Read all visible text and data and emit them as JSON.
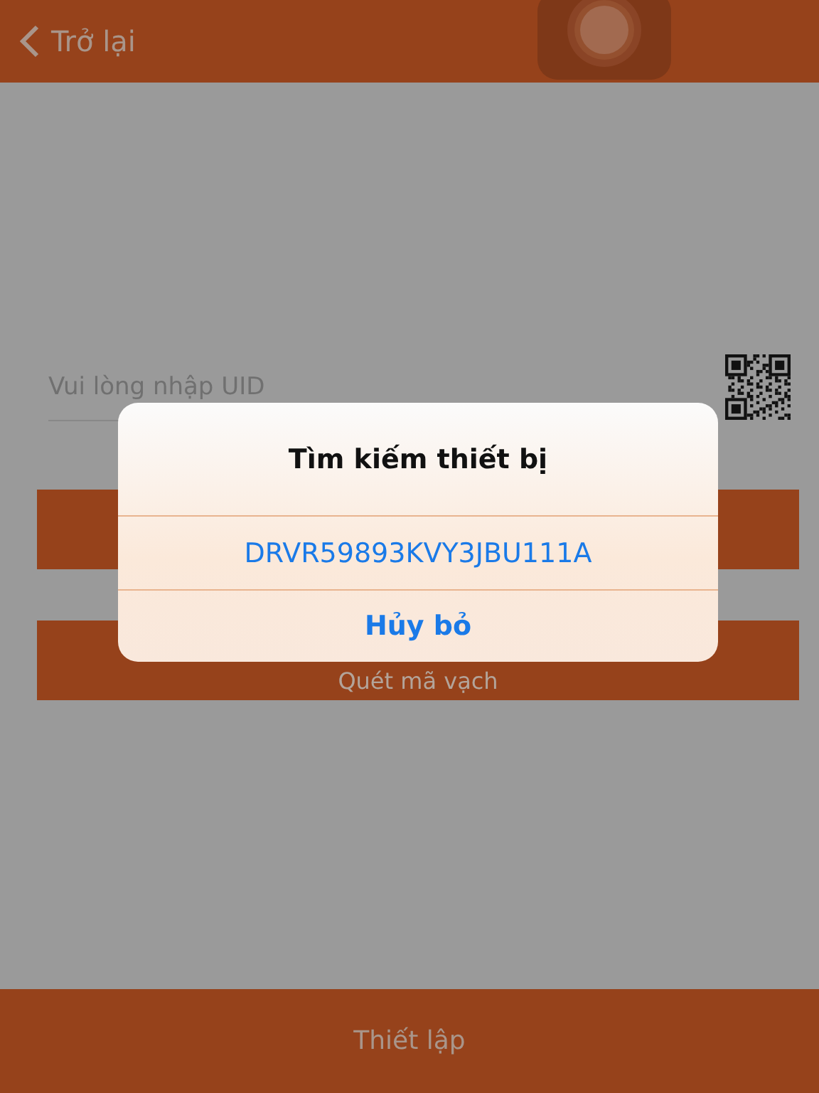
{
  "header": {
    "back_label": "Trở lại"
  },
  "uid_field": {
    "placeholder": "Vui lòng nhập UID"
  },
  "buttons": [
    {
      "kind": "covered"
    },
    {
      "kind": "labeled",
      "label": "Quét mã vạch"
    }
  ],
  "footer_button": {
    "label": "Thiết lập"
  },
  "alert": {
    "title": "Tìm kiếm thiết bị",
    "actions": [
      {
        "label": "DRVR59893KVY3JBU111A",
        "kind": "option"
      },
      {
        "label": "Hủy bỏ",
        "kind": "cancel"
      }
    ]
  }
}
